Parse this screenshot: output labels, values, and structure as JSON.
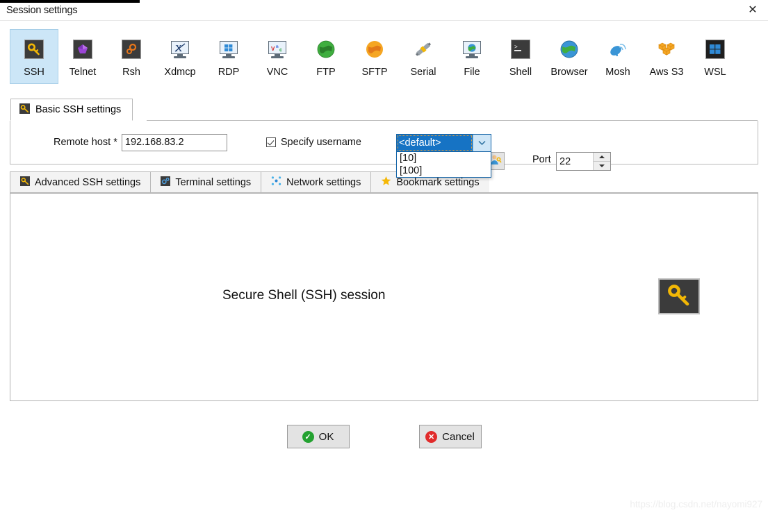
{
  "window": {
    "title": "Session settings",
    "close_label": "✕"
  },
  "protocols": [
    {
      "label": "SSH",
      "icon": "key-icon",
      "selected": true
    },
    {
      "label": "Telnet",
      "icon": "purple-gem-icon",
      "selected": false
    },
    {
      "label": "Rsh",
      "icon": "orange-gears-icon",
      "selected": false
    },
    {
      "label": "Xdmcp",
      "icon": "x-monitor-icon",
      "selected": false
    },
    {
      "label": "RDP",
      "icon": "windows-monitor-icon",
      "selected": false
    },
    {
      "label": "VNC",
      "icon": "vnc-monitor-icon",
      "selected": false
    },
    {
      "label": "FTP",
      "icon": "green-globe-icon",
      "selected": false
    },
    {
      "label": "SFTP",
      "icon": "orange-globe-icon",
      "selected": false
    },
    {
      "label": "Serial",
      "icon": "plug-connector-icon",
      "selected": false
    },
    {
      "label": "File",
      "icon": "globe-monitor-icon",
      "selected": false
    },
    {
      "label": "Shell",
      "icon": "terminal-prompt-icon",
      "selected": false
    },
    {
      "label": "Browser",
      "icon": "blue-globe-icon",
      "selected": false
    },
    {
      "label": "Mosh",
      "icon": "satellite-dish-icon",
      "selected": false
    },
    {
      "label": "Aws S3",
      "icon": "orange-cubes-icon",
      "selected": false
    },
    {
      "label": "WSL",
      "icon": "windows-logo-icon",
      "selected": false
    }
  ],
  "basic_tab": {
    "label": "Basic SSH settings",
    "icon": "key-icon"
  },
  "form": {
    "remote_host_label": "Remote host *",
    "remote_host_value": "192.168.83.2",
    "specify_username_label": "Specify username",
    "specify_username_checked": true,
    "username_value": "<default>",
    "username_options": [
      "[10]",
      "[100]"
    ],
    "user_button_icon": "user-key-icon",
    "port_label": "Port",
    "port_value": "22"
  },
  "tabs": [
    {
      "label": "Advanced SSH settings",
      "icon": "key-icon"
    },
    {
      "label": "Terminal settings",
      "icon": "terminal-gear-icon"
    },
    {
      "label": "Network settings",
      "icon": "network-nodes-icon"
    },
    {
      "label": "Bookmark settings",
      "icon": "star-icon"
    }
  ],
  "content": {
    "session_description": "Secure Shell (SSH) session",
    "session_icon": "key-icon"
  },
  "footer": {
    "ok_label": "OK",
    "ok_badge": "✓",
    "cancel_label": "Cancel",
    "cancel_badge": "✕"
  },
  "watermark": "https://blog.csdn.net/nayomi927",
  "colors": {
    "selected_tile": "#cce6f7",
    "combo_highlight": "#1673c4",
    "ok_green": "#24a231",
    "cancel_red": "#e12b2b"
  }
}
